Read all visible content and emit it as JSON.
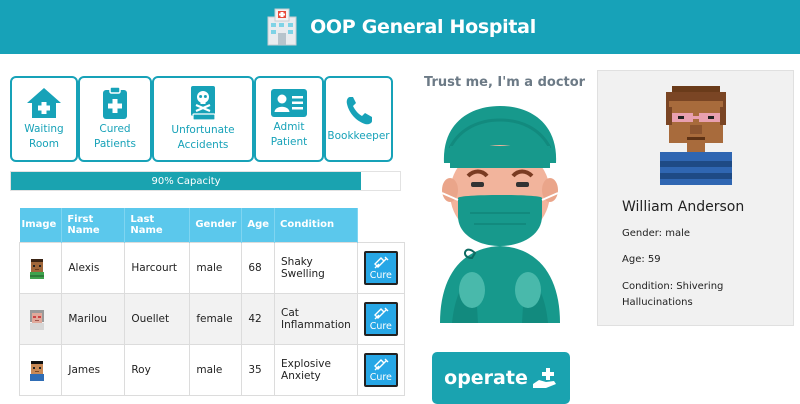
{
  "header": {
    "title": "OOP General Hospital"
  },
  "nav": [
    {
      "label": "Waiting Room",
      "icon": "home-icon"
    },
    {
      "label": "Cured Patients",
      "icon": "clipboard-medical-icon"
    },
    {
      "label": "Unfortunate Accidents",
      "icon": "skull-book-icon"
    },
    {
      "label": "Admit Patient",
      "icon": "id-card-icon"
    },
    {
      "label": "Bookkeeper",
      "icon": "phone-icon"
    }
  ],
  "capacity": {
    "label": "90% Capacity",
    "value": 0.9
  },
  "table": {
    "headers": [
      "Image",
      "First Name",
      "Last Name",
      "Gender",
      "Age",
      "Condition"
    ],
    "rows": [
      {
        "first": "Alexis",
        "last": "Harcourt",
        "gender": "male",
        "age": "68",
        "condition": "Shaky Swelling",
        "action": "Cure"
      },
      {
        "first": "Marilou",
        "last": "Ouellet",
        "gender": "female",
        "age": "42",
        "condition": "Cat Inflammation",
        "action": "Cure"
      },
      {
        "first": "James",
        "last": "Roy",
        "gender": "male",
        "age": "35",
        "condition": "Explosive Anxiety",
        "action": "Cure"
      }
    ]
  },
  "doctor": {
    "caption": "Trust me, I'm a doctor"
  },
  "operate": {
    "label": "operate"
  },
  "profile": {
    "name": "William Anderson",
    "gender": "Gender: male",
    "age": "Age: 59",
    "condition": "Condition: Shivering Hallucinations"
  },
  "colors": {
    "primary": "#17a2b8",
    "table_header": "#5bc8ec",
    "cure_button": "#27a7e6"
  }
}
